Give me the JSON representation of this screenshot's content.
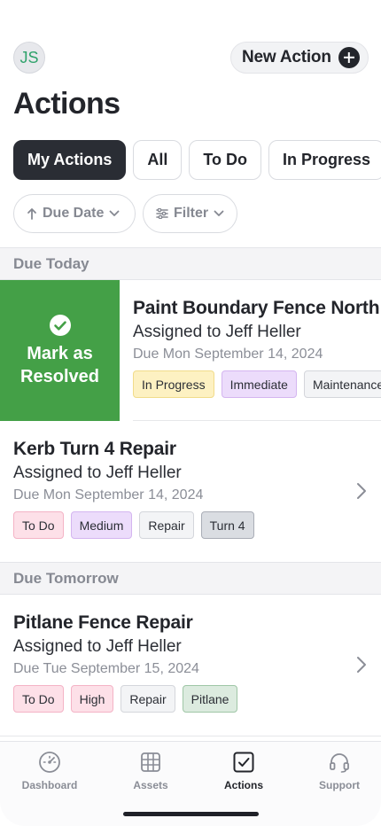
{
  "header": {
    "avatar_initials": "JS",
    "new_action_label": "New Action",
    "title": "Actions"
  },
  "tabs": [
    {
      "label": "My Actions",
      "active": true
    },
    {
      "label": "All",
      "active": false
    },
    {
      "label": "To Do",
      "active": false
    },
    {
      "label": "In Progress",
      "active": false
    }
  ],
  "sort": {
    "label": "Due Date",
    "direction": "ascending"
  },
  "filter": {
    "label": "Filter"
  },
  "sections": [
    {
      "heading": "Due Today",
      "items": [
        {
          "title": "Paint Boundary Fence North",
          "assignee": "Assigned to Jeff Heller",
          "due": "Due Mon September 14, 2024",
          "tags": [
            "In Progress",
            "Immediate",
            "Maintenance"
          ],
          "swipe_action": {
            "line1": "Mark as",
            "line2": "Resolved"
          }
        },
        {
          "title": "Kerb Turn 4 Repair",
          "assignee": "Assigned to Jeff Heller",
          "due": "Due Mon September 14, 2024",
          "tags": [
            "To Do",
            "Medium",
            "Repair",
            "Turn 4"
          ]
        }
      ]
    },
    {
      "heading": "Due Tomorrow",
      "items": [
        {
          "title": "Pitlane Fence Repair",
          "assignee": "Assigned to Jeff Heller",
          "due": "Due Tue September 15, 2024",
          "tags": [
            "To Do",
            "High",
            "Repair",
            "Pitlane"
          ]
        }
      ]
    }
  ],
  "bottom_nav": [
    {
      "label": "Dashboard",
      "icon": "gauge-icon",
      "active": false
    },
    {
      "label": "Assets",
      "icon": "grid-globe-icon",
      "active": false
    },
    {
      "label": "Actions",
      "icon": "checkbox-icon",
      "active": true
    },
    {
      "label": "Support",
      "icon": "headset-icon",
      "active": false
    }
  ],
  "colors": {
    "resolve_green": "#44a047",
    "tag_in_progress": "#fdf1c2",
    "tag_immediate": "#ecdcfb",
    "tag_to_do": "#fde0e8",
    "tag_medium": "#ecdcfb",
    "tag_high": "#fde0e8",
    "tag_neutral": "#f3f4f6",
    "tag_turn4": "#dadde2",
    "tag_pitlane": "#dcebdf",
    "active_tab": "#2a2d34"
  }
}
